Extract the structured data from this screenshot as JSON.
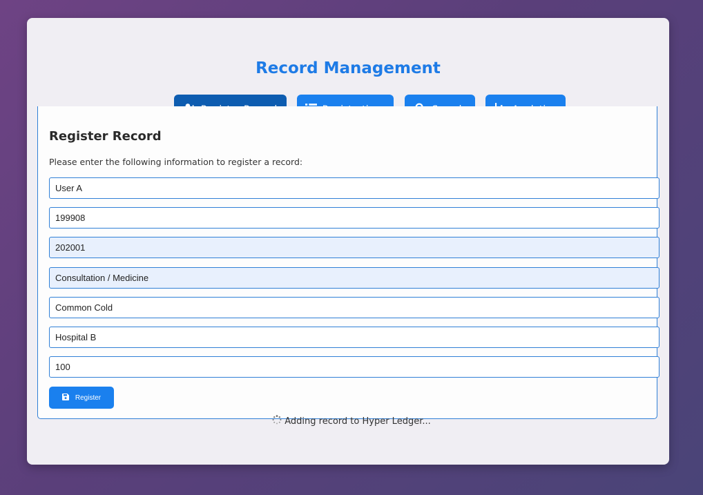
{
  "page": {
    "title": "Record Management"
  },
  "tabs": [
    {
      "label": "Register Record",
      "icon": "user-plus-icon",
      "active": true
    },
    {
      "label": "Registrations",
      "icon": "list-icon",
      "active": false
    },
    {
      "label": "Search",
      "icon": "search-icon",
      "active": false
    },
    {
      "label": "Analytics",
      "icon": "bar-chart-icon",
      "active": false
    }
  ],
  "form": {
    "heading": "Register Record",
    "instructions": "Please enter the following information to register a record:",
    "fields": [
      {
        "value": "User A"
      },
      {
        "value": "199908"
      },
      {
        "value": "202001"
      },
      {
        "value": "Consultation / Medicine"
      },
      {
        "value": "Common Cold"
      },
      {
        "value": "Hospital B"
      },
      {
        "value": "100"
      }
    ],
    "submit_label": "Register",
    "submit_icon": "save-icon"
  },
  "status": {
    "text": "Adding record to Hyper Ledger...",
    "icon": "spinner-icon"
  },
  "colors": {
    "accent": "#1a80ee",
    "accent_active": "#0d5cb0",
    "title": "#1e7be6",
    "field_border": "#2f7fd6",
    "autofill_bg": "#e8f0fd"
  }
}
